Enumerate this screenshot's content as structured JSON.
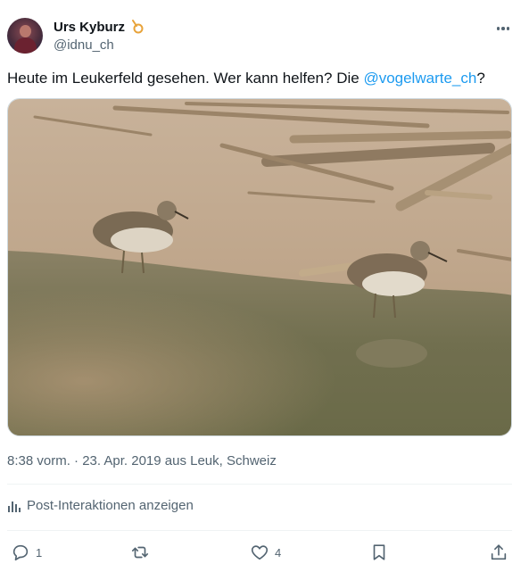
{
  "author": {
    "name": "Urs Kyburz",
    "handle": "@idnu_ch"
  },
  "post": {
    "text": "Heute im Leukerfeld gesehen. Wer kann helfen? Die ",
    "mention": "@vogelwarte_ch",
    "text_end": "?",
    "meta": "8:38 vorm. · 23. Apr. 2019 aus Leuk, Schweiz"
  },
  "analytics_label": "Post-Interaktionen anzeigen",
  "actions": {
    "reply_count": "1",
    "repost_count": "",
    "like_count": "4"
  },
  "colors": {
    "accent": "#1d9bf0",
    "secondary_text": "#536471",
    "badge": "#e8a33a"
  },
  "icons": [
    "more-icon",
    "reply-icon",
    "repost-icon",
    "like-icon",
    "bookmark-icon",
    "share-icon",
    "analytics-icon",
    "label-badge-icon"
  ]
}
